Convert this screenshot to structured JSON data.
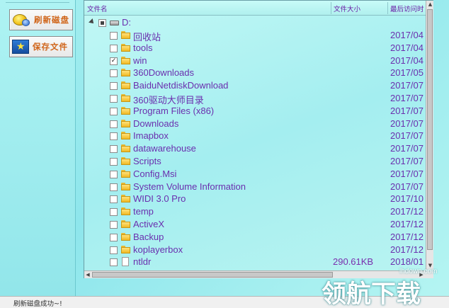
{
  "sidebar": {
    "refresh_label": "刷新磁盘",
    "save_label": "保存文件"
  },
  "tree": {
    "columns": [
      "文件名",
      "文件大小",
      "最后访问时"
    ],
    "root": {
      "name": "D:",
      "checked": "partial"
    },
    "items": [
      {
        "name": "回收站",
        "size": "",
        "date": "2017/04",
        "checked": false,
        "type": "folder"
      },
      {
        "name": "tools",
        "size": "",
        "date": "2017/04",
        "checked": false,
        "type": "folder"
      },
      {
        "name": "win",
        "size": "",
        "date": "2017/04",
        "checked": true,
        "type": "folder"
      },
      {
        "name": "360Downloads",
        "size": "",
        "date": "2017/05",
        "checked": false,
        "type": "folder"
      },
      {
        "name": "BaiduNetdiskDownload",
        "size": "",
        "date": "2017/07",
        "checked": false,
        "type": "folder"
      },
      {
        "name": "360驱动大师目录",
        "size": "",
        "date": "2017/07",
        "checked": false,
        "type": "folder"
      },
      {
        "name": "Program Files (x86)",
        "size": "",
        "date": "2017/07",
        "checked": false,
        "type": "folder"
      },
      {
        "name": "Downloads",
        "size": "",
        "date": "2017/07",
        "checked": false,
        "type": "folder"
      },
      {
        "name": "Imapbox",
        "size": "",
        "date": "2017/07",
        "checked": false,
        "type": "folder"
      },
      {
        "name": "datawarehouse",
        "size": "",
        "date": "2017/07",
        "checked": false,
        "type": "folder"
      },
      {
        "name": "Scripts",
        "size": "",
        "date": "2017/07",
        "checked": false,
        "type": "folder"
      },
      {
        "name": "Config.Msi",
        "size": "",
        "date": "2017/07",
        "checked": false,
        "type": "folder"
      },
      {
        "name": "System Volume Information",
        "size": "",
        "date": "2017/07",
        "checked": false,
        "type": "folder"
      },
      {
        "name": "WIDI 3.0 Pro",
        "size": "",
        "date": "2017/10",
        "checked": false,
        "type": "folder"
      },
      {
        "name": "temp",
        "size": "",
        "date": "2017/12",
        "checked": false,
        "type": "folder"
      },
      {
        "name": "ActiveX",
        "size": "",
        "date": "2017/12",
        "checked": false,
        "type": "folder"
      },
      {
        "name": "Backup",
        "size": "",
        "date": "2017/12",
        "checked": false,
        "type": "folder"
      },
      {
        "name": "koplayerbox",
        "size": "",
        "date": "2017/12",
        "checked": false,
        "type": "folder"
      },
      {
        "name": "ntldr",
        "size": "290.61KB",
        "date": "2018/01",
        "checked": false,
        "type": "file"
      }
    ]
  },
  "status": {
    "text": "刷新磁盘成功~!"
  },
  "watermark": {
    "url": "lhdown.com",
    "text": "领航下载"
  }
}
